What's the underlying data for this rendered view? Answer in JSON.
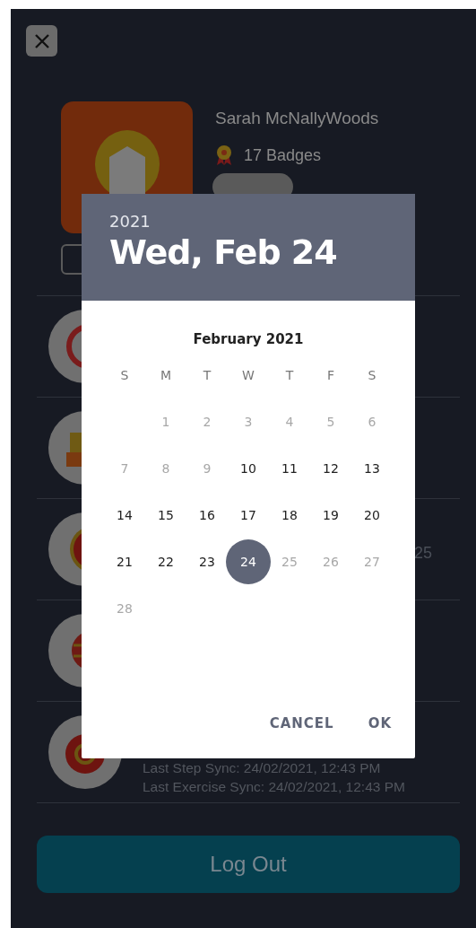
{
  "profile": {
    "name": "Sarah McNallyWoods",
    "badges": "17 Badges"
  },
  "rows": [
    {
      "kind": "target"
    },
    {
      "kind": "board"
    },
    {
      "kind": "dial",
      "fragment": "25"
    },
    {
      "kind": "globe"
    },
    {
      "kind": "sync",
      "lines": [
        "Last Step Sync: 24/02/2021, 12:43 PM",
        "Last Exercise Sync: 24/02/2021, 12:43 PM"
      ]
    }
  ],
  "log_out": "Log Out",
  "date_picker": {
    "year": "2021",
    "date": "Wed, Feb 24",
    "month": "February 2021",
    "weekdays": [
      "S",
      "M",
      "T",
      "W",
      "T",
      "F",
      "S"
    ],
    "weeks": [
      [
        {
          "day": "1",
          "disabled": true,
          "selected": false
        },
        {
          "day": "2",
          "disabled": true,
          "selected": false
        },
        {
          "day": "3",
          "disabled": true,
          "selected": false
        },
        {
          "day": "4",
          "disabled": true,
          "selected": false
        },
        {
          "day": "5",
          "disabled": true,
          "selected": false
        },
        {
          "day": "6",
          "disabled": true,
          "selected": false
        }
      ],
      [
        {
          "day": "7",
          "disabled": true,
          "selected": false
        },
        {
          "day": "8",
          "disabled": true,
          "selected": false
        },
        {
          "day": "9",
          "disabled": true,
          "selected": false
        },
        {
          "day": "10",
          "disabled": false,
          "selected": false
        },
        {
          "day": "11",
          "disabled": false,
          "selected": false
        },
        {
          "day": "12",
          "disabled": false,
          "selected": false
        },
        {
          "day": "13",
          "disabled": false,
          "selected": false
        }
      ],
      [
        {
          "day": "14",
          "disabled": false,
          "selected": false
        },
        {
          "day": "15",
          "disabled": false,
          "selected": false
        },
        {
          "day": "16",
          "disabled": false,
          "selected": false
        },
        {
          "day": "17",
          "disabled": false,
          "selected": false
        },
        {
          "day": "18",
          "disabled": false,
          "selected": false
        },
        {
          "day": "19",
          "disabled": false,
          "selected": false
        },
        {
          "day": "20",
          "disabled": false,
          "selected": false
        }
      ],
      [
        {
          "day": "21",
          "disabled": false,
          "selected": false
        },
        {
          "day": "22",
          "disabled": false,
          "selected": false
        },
        {
          "day": "23",
          "disabled": false,
          "selected": false
        },
        {
          "day": "24",
          "disabled": false,
          "selected": true
        },
        {
          "day": "25",
          "disabled": true,
          "selected": false
        },
        {
          "day": "26",
          "disabled": true,
          "selected": false
        },
        {
          "day": "27",
          "disabled": true,
          "selected": false
        }
      ],
      [
        {
          "day": "28",
          "disabled": true,
          "selected": false
        }
      ]
    ],
    "buttons": [
      "CANCEL",
      "OK"
    ]
  }
}
